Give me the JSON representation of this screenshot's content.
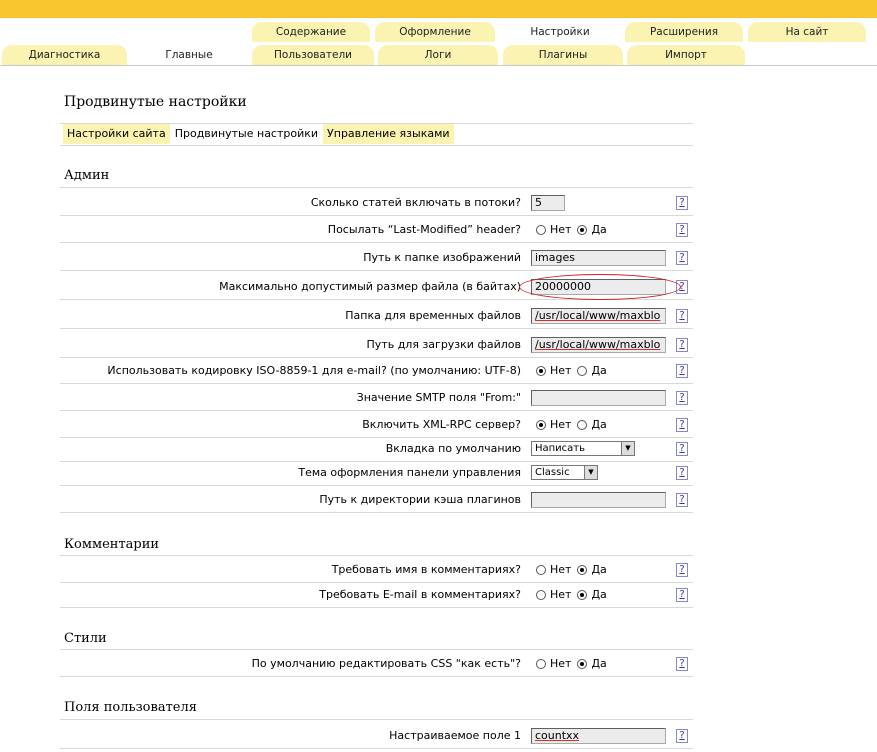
{
  "top_tabs": [
    {
      "label": "Содержание",
      "active": false
    },
    {
      "label": "Оформление",
      "active": false
    },
    {
      "label": "Настройки",
      "active": true
    },
    {
      "label": "Расширения",
      "active": false
    },
    {
      "label": "На сайт",
      "active": false
    }
  ],
  "sub_tabs": [
    {
      "label": "Диагностика",
      "active": false
    },
    {
      "label": "Главные",
      "active": true
    },
    {
      "label": "Пользователи",
      "active": false
    },
    {
      "label": "Логи",
      "active": false
    },
    {
      "label": "Плагины",
      "active": false
    },
    {
      "label": "Импорт",
      "active": false
    }
  ],
  "page_title": "Продвинутые настройки",
  "settings_tabs": [
    {
      "label": "Настройки сайта",
      "active": false
    },
    {
      "label": "Продвинутые настройки",
      "active": true
    },
    {
      "label": "Управление языками",
      "active": false
    }
  ],
  "help_label": "?",
  "radio_labels": {
    "no": "Нет",
    "yes": "Да"
  },
  "sections": {
    "admin": "Админ",
    "comments": "Комментарии",
    "styles": "Стили",
    "user_fields": "Поля пользователя"
  },
  "admin_rows": {
    "articles": {
      "label": "Сколько статей включать в потоки?",
      "value": "5"
    },
    "last_modified": {
      "label": "Посылать “Last-Modified” header?",
      "selected": "yes"
    },
    "image_path": {
      "label": "Путь к папке изображений",
      "value": "images"
    },
    "max_file_size": {
      "label": "Максимально допустимый размер файла (в байтах)",
      "value": "20000000"
    },
    "temp_path": {
      "label": "Папка для временных файлов",
      "value": "/usr/local/www/maxblo"
    },
    "upload_path": {
      "label": "Путь для загрузки файлов",
      "value": "/usr/local/www/maxblo"
    },
    "iso_encoding": {
      "label": "Использовать кодировку ISO-8859-1 для e-mail? (по умолчанию: UTF-8)",
      "selected": "no"
    },
    "smtp_from": {
      "label": "Значение SMTP поля \"From:\"",
      "value": ""
    },
    "xml_rpc": {
      "label": "Включить XML-RPC сервер?",
      "selected": "no"
    },
    "default_tab": {
      "label": "Вкладка по умолчанию",
      "value": "Написать"
    },
    "admin_theme": {
      "label": "Тема оформления панели управления",
      "value": "Classic"
    },
    "plugin_cache": {
      "label": "Путь к директории кэша плагинов",
      "value": ""
    }
  },
  "comment_rows": {
    "require_name": {
      "label": "Требовать имя в комментариях?",
      "selected": "yes"
    },
    "require_email": {
      "label": "Требовать E-mail в комментариях?",
      "selected": "yes"
    }
  },
  "style_rows": {
    "raw_css": {
      "label": "По умолчанию редактировать CSS \"как есть\"?",
      "selected": "yes"
    }
  },
  "user_field_rows": {
    "custom1": {
      "label": "Настраиваемое поле 1",
      "value": "countxx"
    }
  },
  "colors": {
    "topbar": "#f7c52d",
    "tab": "#faf3b2",
    "highlight": "#cc2222"
  }
}
